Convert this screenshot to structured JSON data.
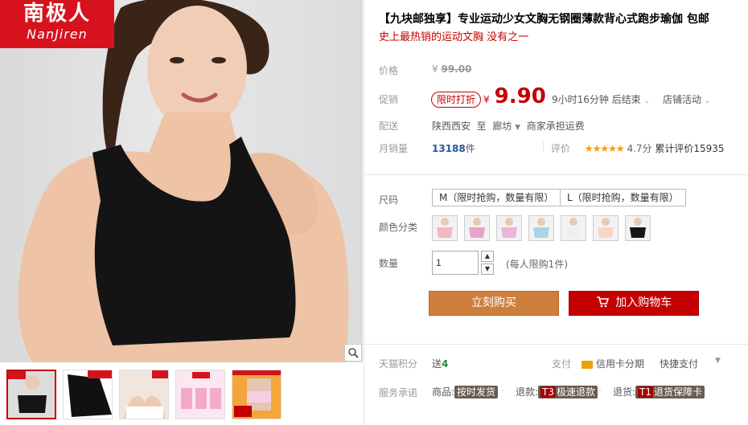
{
  "logo": {
    "cn": "南极人",
    "en": "NanJiren"
  },
  "title": "【九块邮独享】专业运动少女文胸无钢圈薄款背心式跑步瑜伽 包邮",
  "subtitle": "史上最热销的运动文胸 没有之一",
  "labels": {
    "price": "价格",
    "promo": "促销",
    "delivery": "配送",
    "monthly_sales": "月销量",
    "size": "尺码",
    "color": "颜色分类",
    "quantity": "数量",
    "points": "天猫积分",
    "service": "服务承诺"
  },
  "price": {
    "currency": "¥",
    "original": "99.00"
  },
  "promo": {
    "badge": "限时打折",
    "currency": "¥",
    "value": "9.90",
    "countdown": "9小时16分钟 后结束",
    "shop_activity": "店铺活动"
  },
  "delivery": {
    "from": "陕西西安",
    "to_word": "至",
    "to": "廊坊",
    "note": "商家承担运费"
  },
  "sales": {
    "count": "13188",
    "unit": "件",
    "rating_label": "评价",
    "stars": "★★★★★",
    "score": "4.7分",
    "total": "累计评价15935"
  },
  "sizes": [
    "M（限时抢购，数量有限）",
    "L（限时抢购，数量有限）"
  ],
  "quantity": {
    "value": "1",
    "note": "(每人限购1件)"
  },
  "buttons": {
    "buy": "立刻购买",
    "cart": "加入购物车"
  },
  "points": {
    "value_prefix": "送",
    "value": "4"
  },
  "payment": {
    "label": "支付",
    "credit": "信用卡分期",
    "quick": "快捷支付"
  },
  "services": {
    "goods_label": "商品:",
    "goods_tag": "按时发货",
    "refund_label": "退款:",
    "refund_lead": "T3",
    "refund_tag": "极速退款",
    "return_label": "退货:",
    "return_lead": "T1",
    "return_tag": "退货保障卡"
  },
  "colors": {
    "accent": "#c40000",
    "buy": "#cf7f3c",
    "cart": "#c40000",
    "logo_bg": "#d6121d"
  },
  "swatch_colors": [
    "#f3b6c6",
    "#e9a3c7",
    "#ecb5d6",
    "#a8d4e8",
    "#f1eef2",
    "#f6d7c4",
    "#151515"
  ],
  "icons": {
    "zoom": "magnifier-icon",
    "cart": "cart-icon",
    "credit": "credit-card-icon"
  }
}
